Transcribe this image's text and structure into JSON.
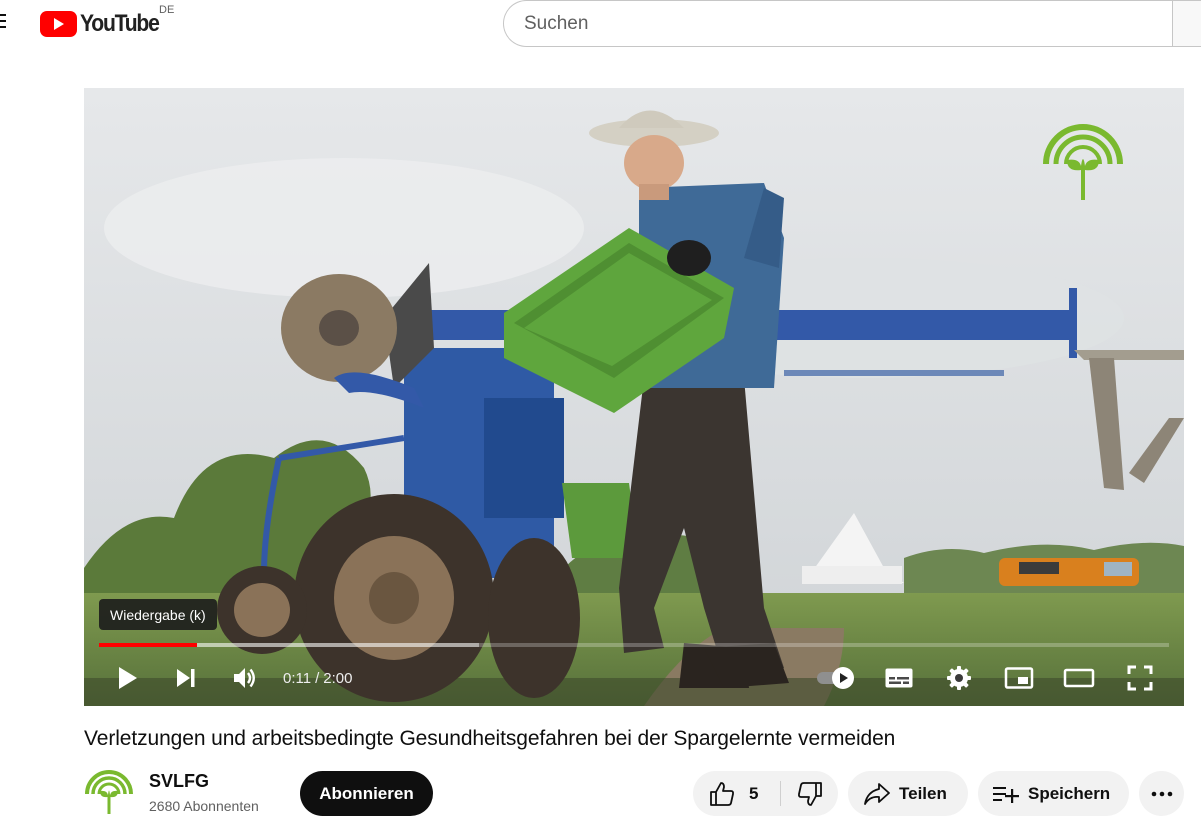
{
  "header": {
    "logo_text": "YouTube",
    "country_code": "DE",
    "search_placeholder": "Suchen"
  },
  "player": {
    "tooltip": "Wiedergabe (k)",
    "current_time": "0:11",
    "time_separator": "/",
    "duration": "2:00",
    "played_fraction": 0.092,
    "buffered_fraction": 0.355,
    "progress_color": "#ff0000",
    "autoplay": "on",
    "watermark": "svlfg-logo"
  },
  "video": {
    "title": "Verletzungen und arbeitsbedingte Gesundheitsgefahren bei der Spargelernte vermeiden"
  },
  "channel": {
    "name": "SVLFG",
    "subscribers": "2680 Abonnenten",
    "avatar": "svlfg-logo",
    "brand_color": "#7ab92f"
  },
  "actions": {
    "subscribe_label": "Abonnieren",
    "like_count": "5",
    "share_label": "Teilen",
    "save_label": "Speichern"
  }
}
